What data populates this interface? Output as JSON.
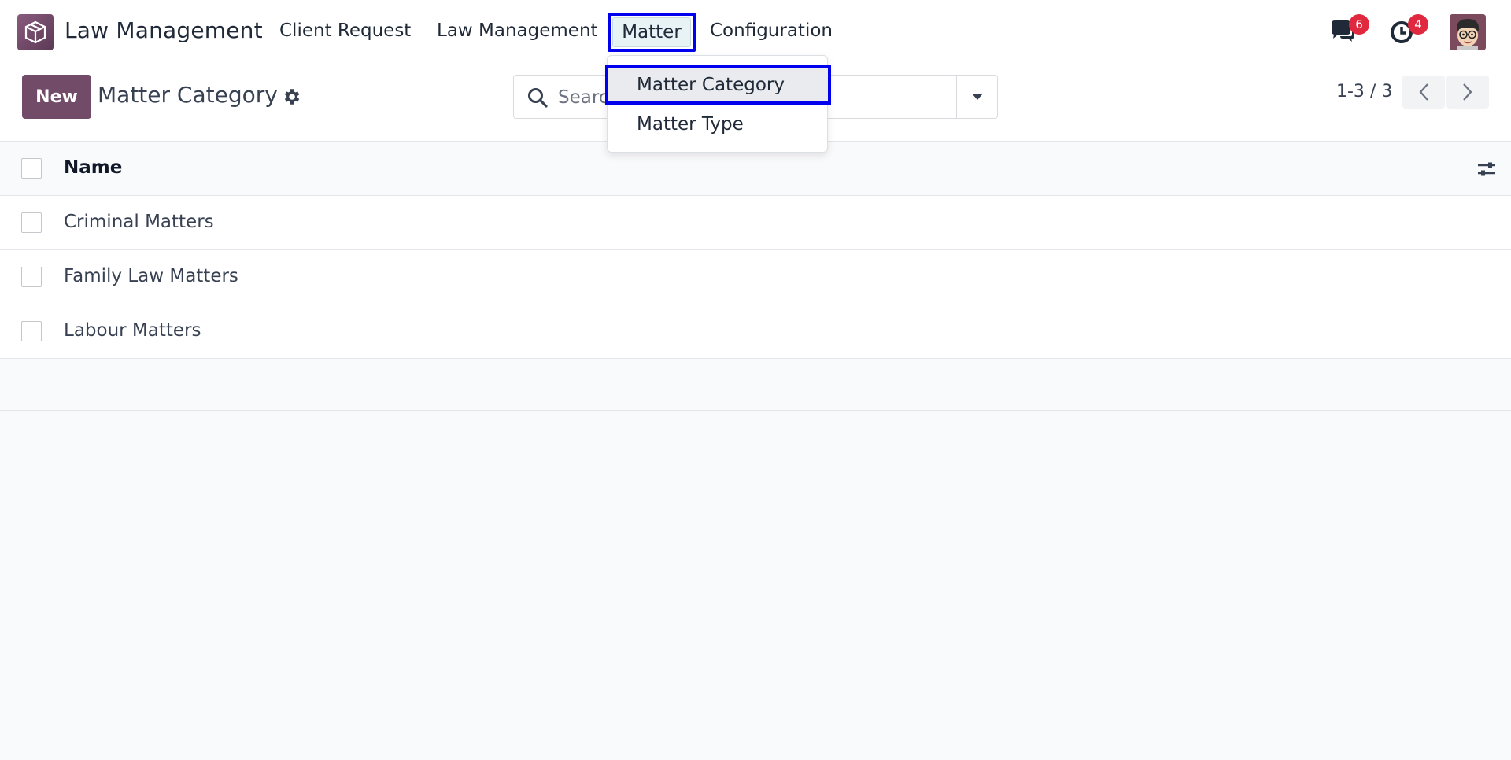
{
  "navbar": {
    "app_name": "Law Management",
    "menus": [
      "Client Request",
      "Law Management",
      "Matter",
      "Configuration"
    ],
    "messages_badge": "6",
    "activities_badge": "4"
  },
  "control_panel": {
    "new_button": "New",
    "title": "Matter Category",
    "search_placeholder": "Search...",
    "pager": "1-3 / 3"
  },
  "list": {
    "header": "Name",
    "rows": [
      "Criminal Matters",
      "Family Law Matters",
      "Labour Matters"
    ]
  },
  "dropdown": {
    "items": [
      "Matter Category",
      "Matter Type"
    ]
  },
  "colors": {
    "brand": "#714b67",
    "badge": "#e0283f",
    "highlight": "#0000ee"
  },
  "icons": [
    "app-logo-icon",
    "chat-icon",
    "clock-icon",
    "gear-icon",
    "search-icon",
    "caret-down-icon",
    "chevron-left-icon",
    "chevron-right-icon",
    "optional-columns-icon"
  ]
}
